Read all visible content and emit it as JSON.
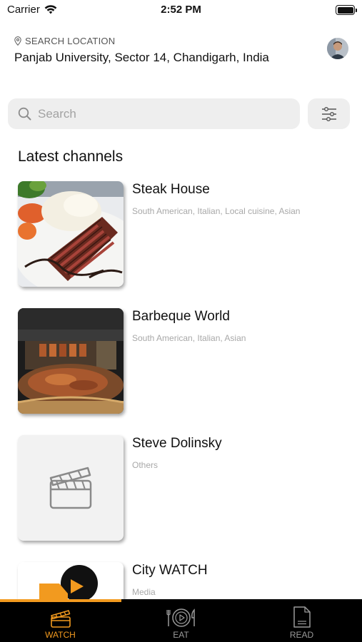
{
  "status_bar": {
    "carrier": "Carrier",
    "time": "2:52 PM"
  },
  "location": {
    "label": "SEARCH LOCATION",
    "value": "Panjab University, Sector 14, Chandigarh, India"
  },
  "search": {
    "placeholder": "Search"
  },
  "section_title": "Latest channels",
  "channels": [
    {
      "name": "Steak House",
      "tags": "South American, Italian, Local cuisine, Asian"
    },
    {
      "name": "Barbeque World",
      "tags": "South American, Italian, Asian"
    },
    {
      "name": "Steve Dolinsky",
      "tags": "Others"
    },
    {
      "name": "City WATCH",
      "tags": "Media"
    }
  ],
  "tabs": [
    {
      "label": "WATCH",
      "icon": "clapperboard-icon",
      "active": true
    },
    {
      "label": "EAT",
      "icon": "plate-cutlery-icon",
      "active": false
    },
    {
      "label": "READ",
      "icon": "document-icon",
      "active": false
    }
  ],
  "colors": {
    "accent": "#f29a1f",
    "tab_bar": "#000000",
    "search_bg": "#eeeeee",
    "muted_text": "#a8a8a8"
  }
}
